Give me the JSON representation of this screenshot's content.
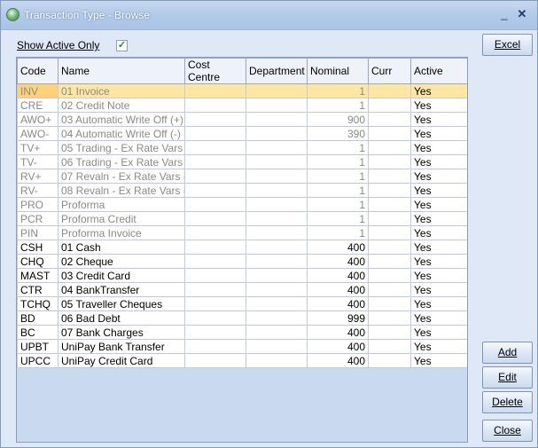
{
  "window": {
    "title": "Transaction Type - Browse",
    "min_glyph": "_",
    "close_glyph": "✕"
  },
  "filter": {
    "show_active_label": "Show Active Only",
    "checked_glyph": "✓"
  },
  "grid": {
    "columns": [
      "Code",
      "Name",
      "Cost Centre",
      "Department",
      "Nominal",
      "Curr",
      "Active"
    ],
    "rows": [
      {
        "code": "INV",
        "name": "01 Invoice",
        "cost_centre": "",
        "department": "",
        "nominal": "1",
        "curr": "",
        "active": "Yes",
        "inactive": true,
        "selected": true
      },
      {
        "code": "CRE",
        "name": "02 Credit Note",
        "cost_centre": "",
        "department": "",
        "nominal": "1",
        "curr": "",
        "active": "Yes",
        "inactive": true
      },
      {
        "code": "AWO+",
        "name": "03 Automatic Write Off (+)",
        "cost_centre": "",
        "department": "",
        "nominal": "900",
        "curr": "",
        "active": "Yes",
        "inactive": true
      },
      {
        "code": "AWO-",
        "name": "04 Automatic Write Off (-)",
        "cost_centre": "",
        "department": "",
        "nominal": "390",
        "curr": "",
        "active": "Yes",
        "inactive": true
      },
      {
        "code": "TV+",
        "name": "05 Trading - Ex Rate Vars (",
        "cost_centre": "",
        "department": "",
        "nominal": "1",
        "curr": "",
        "active": "Yes",
        "inactive": true
      },
      {
        "code": "TV-",
        "name": "06 Trading - Ex Rate Vars (",
        "cost_centre": "",
        "department": "",
        "nominal": "1",
        "curr": "",
        "active": "Yes",
        "inactive": true
      },
      {
        "code": "RV+",
        "name": "07 Revaln - Ex Rate Vars (",
        "cost_centre": "",
        "department": "",
        "nominal": "1",
        "curr": "",
        "active": "Yes",
        "inactive": true
      },
      {
        "code": "RV-",
        "name": "08 Revaln - Ex Rate Vars (",
        "cost_centre": "",
        "department": "",
        "nominal": "1",
        "curr": "",
        "active": "Yes",
        "inactive": true
      },
      {
        "code": "PRO",
        "name": "Proforma",
        "cost_centre": "",
        "department": "",
        "nominal": "1",
        "curr": "",
        "active": "Yes",
        "inactive": true
      },
      {
        "code": "PCR",
        "name": "Proforma Credit",
        "cost_centre": "",
        "department": "",
        "nominal": "1",
        "curr": "",
        "active": "Yes",
        "inactive": true
      },
      {
        "code": "PIN",
        "name": "Proforma Invoice",
        "cost_centre": "",
        "department": "",
        "nominal": "1",
        "curr": "",
        "active": "Yes",
        "inactive": true
      },
      {
        "code": "CSH",
        "name": "01 Cash",
        "cost_centre": "",
        "department": "",
        "nominal": "400",
        "curr": "",
        "active": "Yes"
      },
      {
        "code": "CHQ",
        "name": "02 Cheque",
        "cost_centre": "",
        "department": "",
        "nominal": "400",
        "curr": "",
        "active": "Yes"
      },
      {
        "code": "MAST",
        "name": "03 Credit Card",
        "cost_centre": "",
        "department": "",
        "nominal": "400",
        "curr": "",
        "active": "Yes"
      },
      {
        "code": "CTR",
        "name": "04 BankTransfer",
        "cost_centre": "",
        "department": "",
        "nominal": "400",
        "curr": "",
        "active": "Yes"
      },
      {
        "code": "TCHQ",
        "name": "05 Traveller Cheques",
        "cost_centre": "",
        "department": "",
        "nominal": "400",
        "curr": "",
        "active": "Yes"
      },
      {
        "code": "BD",
        "name": "06 Bad Debt",
        "cost_centre": "",
        "department": "",
        "nominal": "999",
        "curr": "",
        "active": "Yes"
      },
      {
        "code": "BC",
        "name": "07 Bank Charges",
        "cost_centre": "",
        "department": "",
        "nominal": "400",
        "curr": "",
        "active": "Yes"
      },
      {
        "code": "UPBT",
        "name": "UniPay Bank Transfer",
        "cost_centre": "",
        "department": "",
        "nominal": "400",
        "curr": "",
        "active": "Yes"
      },
      {
        "code": "UPCC",
        "name": "UniPay Credit Card",
        "cost_centre": "",
        "department": "",
        "nominal": "400",
        "curr": "",
        "active": "Yes"
      }
    ]
  },
  "buttons": {
    "excel": "Excel",
    "add": "Add",
    "edit": "Edit",
    "delete": "Delete",
    "close": "Close"
  }
}
